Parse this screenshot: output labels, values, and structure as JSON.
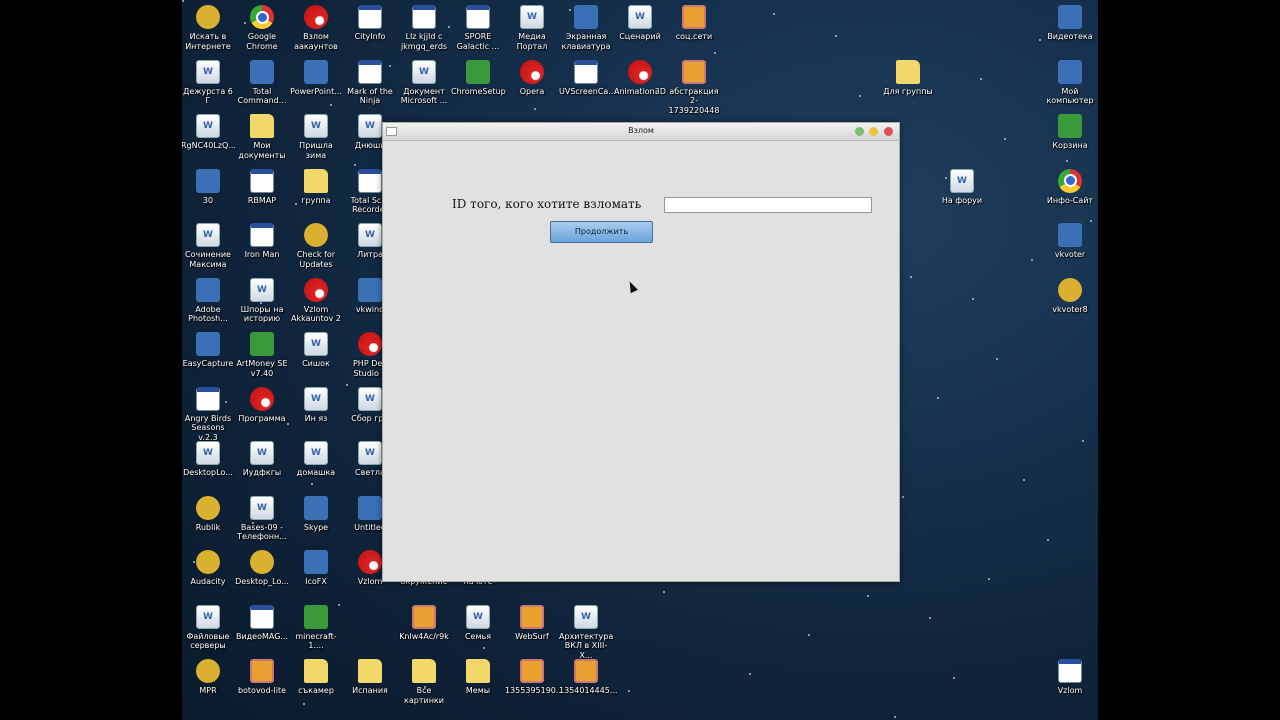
{
  "desktop_icons": [
    {
      "label": "Искать в\nИнтернете",
      "type": "gold"
    },
    {
      "label": "Дежурста 6 Г",
      "type": "doc"
    },
    {
      "label": "RgNC40LzQ...",
      "type": "doc"
    },
    {
      "label": "30",
      "type": "blue"
    },
    {
      "label": "Сочинение\nМаксима",
      "type": "doc"
    },
    {
      "label": "Adobe\nPhotosh...",
      "type": "blue"
    },
    {
      "label": "EasyCapture",
      "type": "blue"
    },
    {
      "label": "Angry Birds\nSeasons v.2.3",
      "type": "win"
    },
    {
      "label": "DesktopLo...",
      "type": "doc"
    },
    {
      "label": "Rublik",
      "type": "gold"
    },
    {
      "label": "Audacity",
      "type": "gold"
    },
    {
      "label": "Файловые\nсерверы",
      "type": "doc"
    },
    {
      "label": "MPR",
      "type": "gold"
    },
    {
      "label": "Google\nChrome",
      "type": "chrome"
    },
    {
      "label": "Total\nCommand...",
      "type": "blue"
    },
    {
      "label": "Мои\nдокументы",
      "type": "folder"
    },
    {
      "label": "RBMAP",
      "type": "win"
    },
    {
      "label": "Iron Man",
      "type": "win"
    },
    {
      "label": "Шпоры на\nисторию",
      "type": "doc"
    },
    {
      "label": "ArtMoney SE\nv7.40",
      "type": "green"
    },
    {
      "label": "Программа",
      "type": "red"
    },
    {
      "label": "Иудфкгы",
      "type": "doc"
    },
    {
      "label": "Bases-09 -\nТелефонн...",
      "type": "doc"
    },
    {
      "label": "Desktop_Lo...",
      "type": "gold"
    },
    {
      "label": "ВидеоMAG...",
      "type": "win"
    },
    {
      "label": "botovod-lite",
      "type": "img"
    },
    {
      "label": "Взлом\nаакаунтов",
      "type": "red"
    },
    {
      "label": "PowerPoint...",
      "type": "blue"
    },
    {
      "label": "Пришла\nзима",
      "type": "doc"
    },
    {
      "label": "группа",
      "type": "folder"
    },
    {
      "label": "Check for\nUpdates",
      "type": "gold"
    },
    {
      "label": "Vzlom\nAkkauntov 2",
      "type": "red"
    },
    {
      "label": "Сишок",
      "type": "doc"
    },
    {
      "label": "Ин яз",
      "type": "doc"
    },
    {
      "label": "домашка",
      "type": "doc"
    },
    {
      "label": "Skype",
      "type": "blue"
    },
    {
      "label": "IcoFX",
      "type": "blue"
    },
    {
      "label": "minecraft-1....",
      "type": "green"
    },
    {
      "label": "съкамер",
      "type": "folder"
    },
    {
      "label": "CityInfo",
      "type": "win"
    },
    {
      "label": "Mark of the\nNinja",
      "type": "win"
    },
    {
      "label": "Днюшк",
      "type": "doc"
    },
    {
      "label": "Total Scre\nRecorder",
      "type": "win"
    },
    {
      "label": "Литра",
      "type": "doc"
    },
    {
      "label": "vkwind",
      "type": "blue"
    },
    {
      "label": "PHP Dev\nStudio 3",
      "type": "red"
    },
    {
      "label": "Сбор гри",
      "type": "doc"
    },
    {
      "label": "Светла",
      "type": "doc"
    },
    {
      "label": "Untitled",
      "type": "blue"
    },
    {
      "label": "Vzlom",
      "type": "red"
    },
    {
      "label": "Испания",
      "type": "folder"
    },
    {
      "label": "Llz kjjld c\njkmgq_erds",
      "type": "win"
    },
    {
      "label": "Документ\nMicrosoft ...",
      "type": "doc"
    },
    {
      "label": "окружение",
      "type": "doc"
    },
    {
      "label": "Knlw4Ac/r9k",
      "type": "img"
    },
    {
      "label": "Все\nкартинки",
      "type": "folder"
    },
    {
      "label": "SPORE\nGalactic ...",
      "type": "win"
    },
    {
      "label": "ChromeSetup",
      "type": "green"
    },
    {
      "label": "на юте",
      "type": "doc"
    },
    {
      "label": "Семья",
      "type": "doc"
    },
    {
      "label": "Мемы",
      "type": "folder"
    },
    {
      "label": "Медиа\nПортал",
      "type": "doc"
    },
    {
      "label": "Opera",
      "type": "red"
    },
    {
      "label": "WebSurf",
      "type": "img"
    },
    {
      "label": "1355395190...",
      "type": "img"
    },
    {
      "label": "Экранная\nклавиатура",
      "type": "blue"
    },
    {
      "label": "UVScreenCa...",
      "type": "win"
    },
    {
      "label": "Архитектура\nВКЛ в XIII-X...",
      "type": "doc"
    },
    {
      "label": "1354014445...",
      "type": "img"
    },
    {
      "label": "Сценарий",
      "type": "doc"
    },
    {
      "label": "Animation3D",
      "type": "red"
    },
    {
      "label": "соц.сети",
      "type": "img"
    },
    {
      "label": "абстракция\n2-1739220448",
      "type": "img"
    },
    {
      "label": "Для группы",
      "type": "folder"
    },
    {
      "label": "На форуи",
      "type": "doc"
    },
    {
      "label": "Видеотека",
      "type": "blue"
    },
    {
      "label": "Мой\nкомпьютер",
      "type": "blue"
    },
    {
      "label": "Корзина",
      "type": "green"
    },
    {
      "label": "Инфо-Сайт",
      "type": "chrome"
    },
    {
      "label": "vkvoter",
      "type": "blue"
    },
    {
      "label": "vkvoter8",
      "type": "gold"
    },
    {
      "label": "Vzlom",
      "type": "win"
    }
  ],
  "window": {
    "title": "Взлом",
    "id_label": "ID того, кого хотите взломать",
    "id_value": "",
    "continue_label": "Продолжить",
    "buttons": {
      "minimize": "#7cc070",
      "maximize": "#f0c040",
      "close": "#e05050"
    }
  }
}
